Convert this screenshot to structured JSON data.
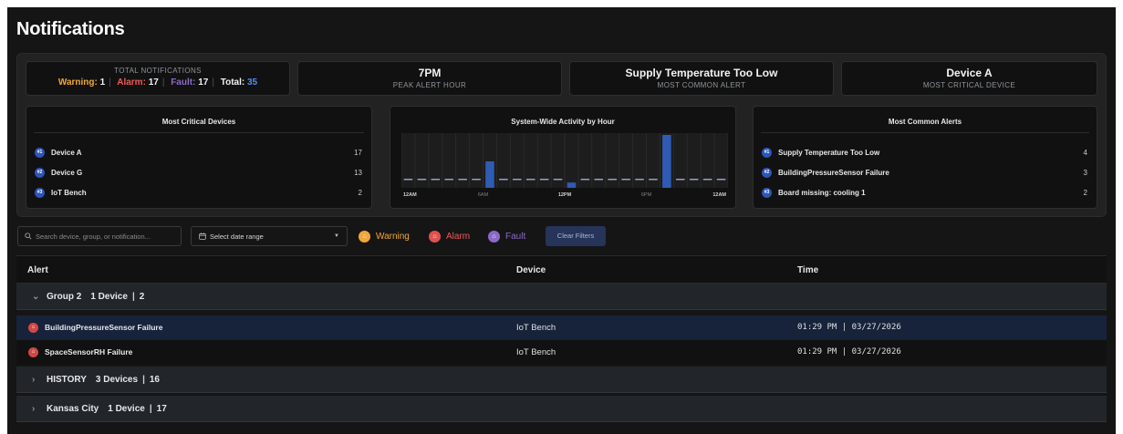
{
  "page": {
    "title": "Notifications"
  },
  "stats": {
    "total_caption": "TOTAL NOTIFICATIONS",
    "warning_label": "Warning:",
    "warning_count": "1",
    "alarm_label": "Alarm:",
    "alarm_count": "17",
    "fault_label": "Fault:",
    "fault_count": "17",
    "total_label": "Total:",
    "total_count": "35",
    "peak_value": "7PM",
    "peak_caption": "PEAK ALERT HOUR",
    "common_value": "Supply Temperature Too Low",
    "common_caption": "MOST COMMON ALERT",
    "critical_value": "Device A",
    "critical_caption": "MOST CRITICAL DEVICE"
  },
  "critical_devices": {
    "title": "Most Critical Devices",
    "items": [
      {
        "rank": "#1",
        "name": "Device A",
        "count": "17"
      },
      {
        "rank": "#2",
        "name": "Device G",
        "count": "13"
      },
      {
        "rank": "#3",
        "name": "IoT Bench",
        "count": "2"
      }
    ]
  },
  "activity": {
    "title": "System-Wide Activity by Hour",
    "x_ticks": [
      "12AM",
      "6AM",
      "12PM",
      "6PM",
      "12AM"
    ]
  },
  "common_alerts": {
    "title": "Most Common Alerts",
    "items": [
      {
        "rank": "#1",
        "name": "Supply Temperature Too Low",
        "count": "4"
      },
      {
        "rank": "#2",
        "name": "BuildingPressureSensor Failure",
        "count": "3"
      },
      {
        "rank": "#3",
        "name": "Board missing: cooling 1",
        "count": "2"
      }
    ]
  },
  "chart_data": {
    "type": "bar",
    "title": "System-Wide Activity by Hour",
    "x_tick_labels": [
      "12AM",
      "6AM",
      "12PM",
      "6PM",
      "12AM"
    ],
    "categories": [
      "0",
      "1",
      "2",
      "3",
      "4",
      "5",
      "6",
      "7",
      "8",
      "9",
      "10",
      "11",
      "12",
      "13",
      "14",
      "15",
      "16",
      "17",
      "18",
      "19",
      "20",
      "21",
      "22",
      "23"
    ],
    "values": [
      0,
      0,
      0,
      0,
      0,
      0,
      10,
      0,
      0,
      0,
      0,
      0,
      2,
      0,
      0,
      0,
      0,
      0,
      0,
      20,
      0,
      0,
      0,
      0
    ],
    "ylim": [
      0,
      20
    ],
    "grid": true,
    "colors": {
      "bar": "#2f5bb5",
      "highlight": "#4f86e8",
      "baseline": "#8fa3c7"
    }
  },
  "filters": {
    "search_placeholder": "Search device, group, or notification...",
    "date_label": "Select date range",
    "warning": "Warning",
    "alarm": "Alarm",
    "fault": "Fault",
    "clear": "Clear Filters",
    "colors": {
      "warning": "#f0a73a",
      "alarm": "#e0514f",
      "fault": "#8c69c9"
    }
  },
  "table": {
    "headers": {
      "alert": "Alert",
      "device": "Device",
      "time": "Time"
    },
    "groups": [
      {
        "name": "Group 2",
        "devices": "1 Device",
        "count": "2"
      },
      {
        "name": "HISTORY",
        "devices": "3 Devices",
        "count": "16"
      },
      {
        "name": "Kansas City",
        "devices": "1 Device",
        "count": "17"
      }
    ],
    "rows": [
      {
        "alert": "BuildingPressureSensor Failure",
        "device": "IoT Bench",
        "time": "01:29 PM | 03/27/2026"
      },
      {
        "alert": "SpaceSensorRH Failure",
        "device": "IoT Bench",
        "time": "01:29 PM | 03/27/2026"
      }
    ]
  }
}
